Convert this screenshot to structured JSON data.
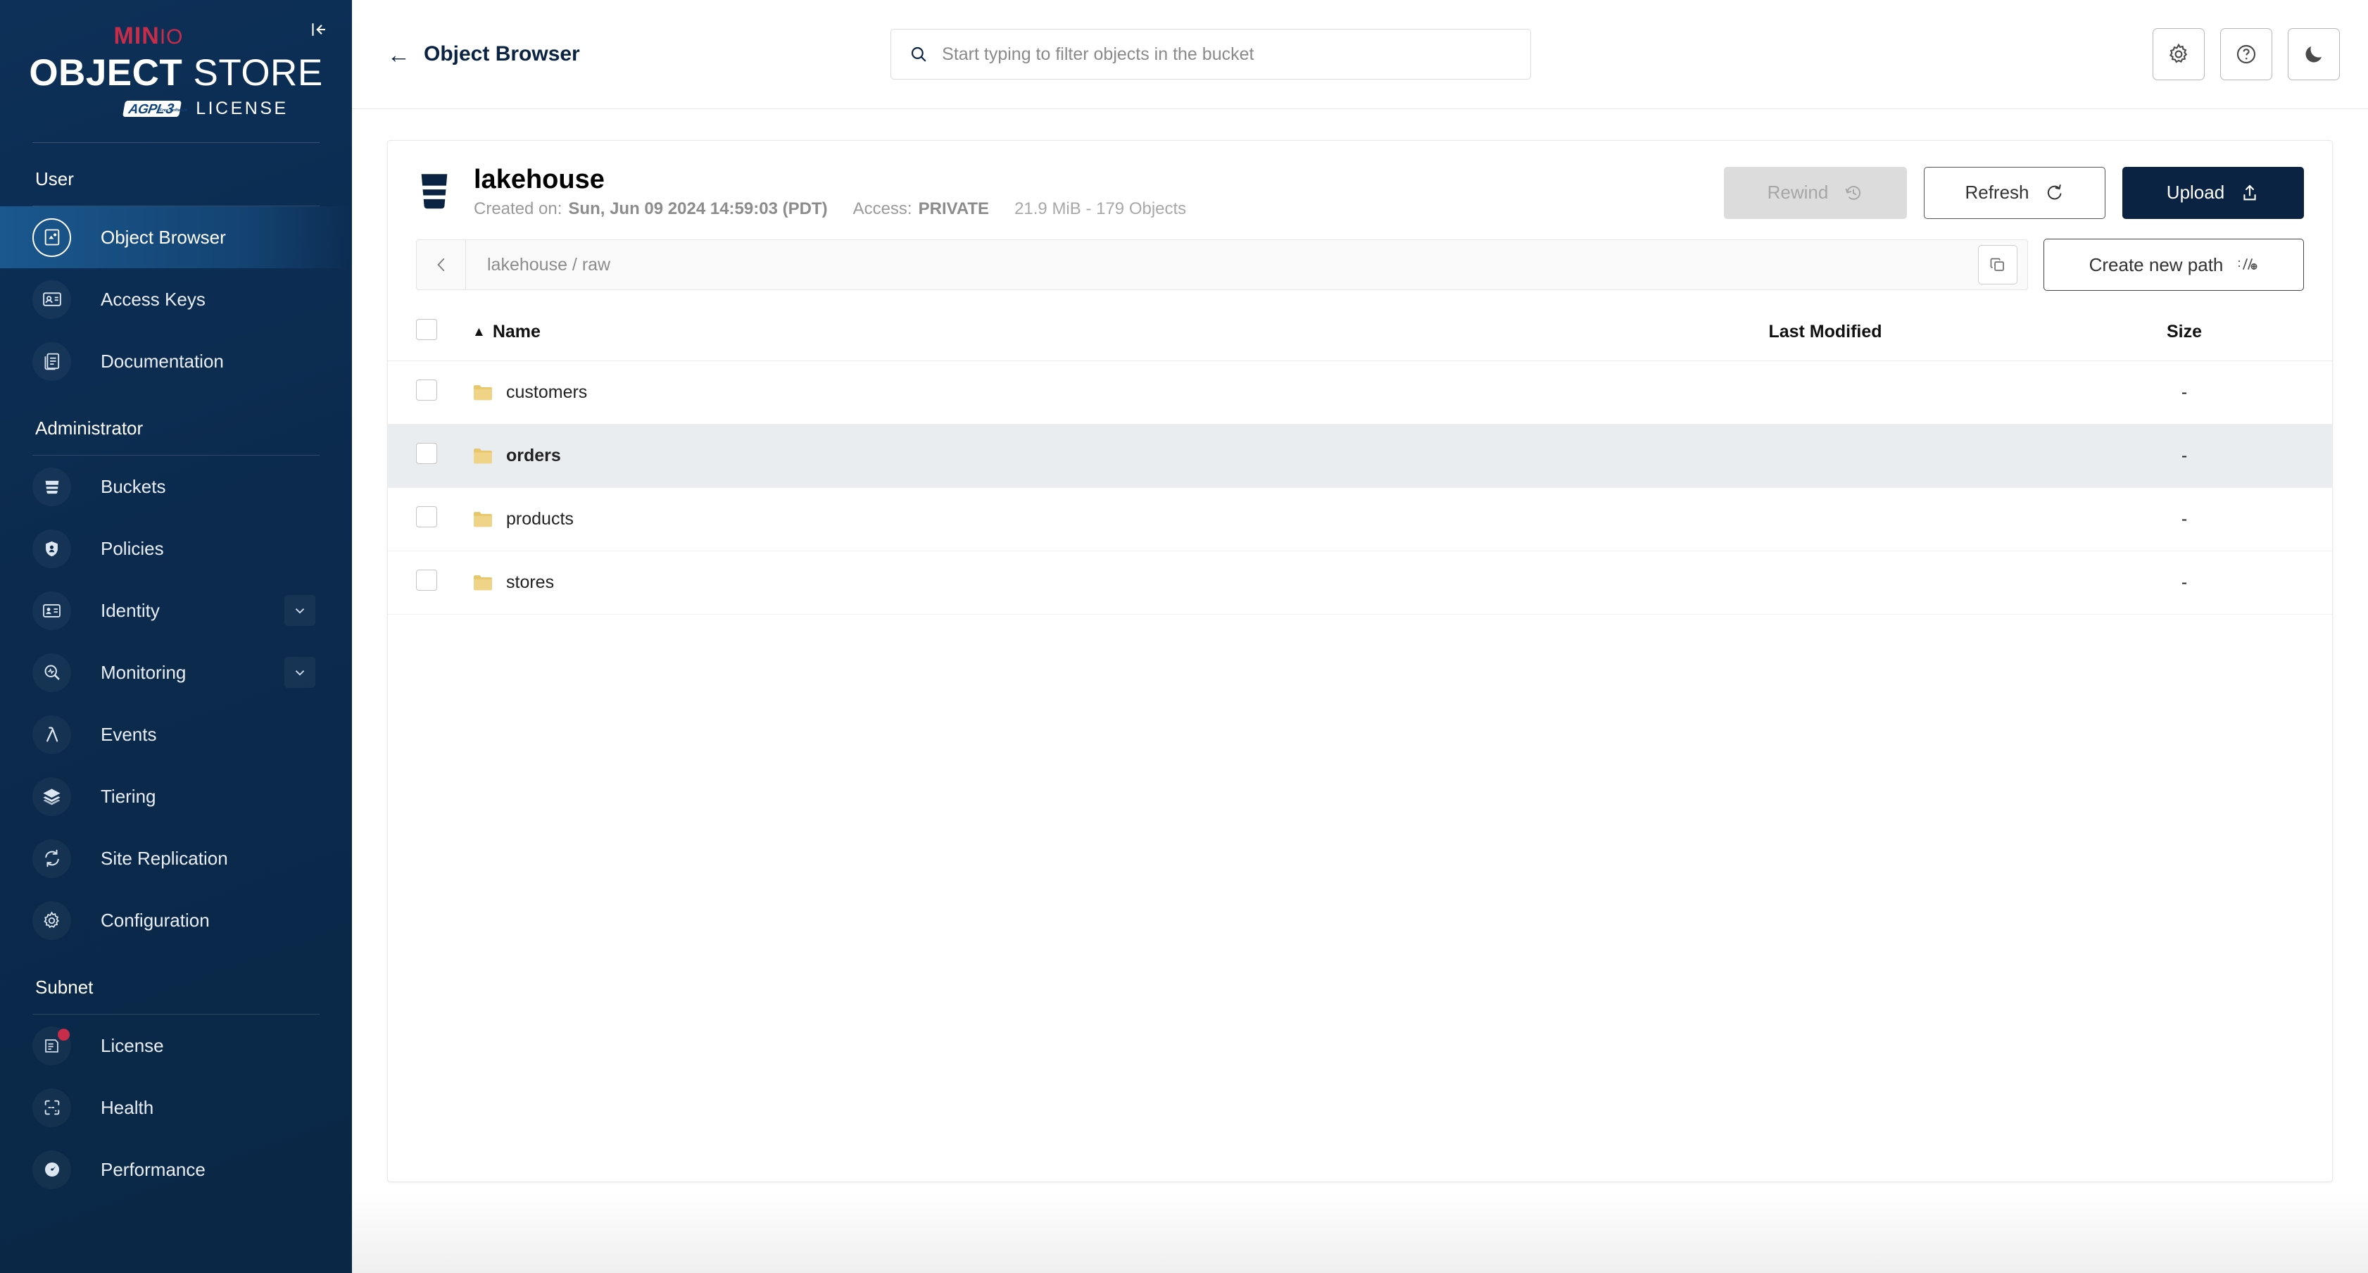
{
  "sidebar": {
    "logo": {
      "brand": "MIN",
      "brand_suffix": "IO",
      "product_bold": "OBJECT",
      "product_light": "STORE",
      "agpl": "AGPL",
      "agpl_sub": "Free Software",
      "agpl_version": "3",
      "license_label": "LICENSE"
    },
    "collapse_icon": "collapse-sidebar-icon",
    "sections": [
      {
        "label": "User",
        "items": [
          {
            "label": "Object Browser",
            "icon": "object-browser-icon",
            "active": true,
            "chevron": false,
            "badge": false
          },
          {
            "label": "Access Keys",
            "icon": "access-keys-icon",
            "active": false,
            "chevron": false,
            "badge": false
          },
          {
            "label": "Documentation",
            "icon": "documentation-icon",
            "active": false,
            "chevron": false,
            "badge": false
          }
        ]
      },
      {
        "label": "Administrator",
        "items": [
          {
            "label": "Buckets",
            "icon": "bucket-icon",
            "active": false,
            "chevron": false,
            "badge": false
          },
          {
            "label": "Policies",
            "icon": "policy-lock-icon",
            "active": false,
            "chevron": false,
            "badge": false
          },
          {
            "label": "Identity",
            "icon": "identity-card-icon",
            "active": false,
            "chevron": true,
            "badge": false
          },
          {
            "label": "Monitoring",
            "icon": "monitoring-magnifier-icon",
            "active": false,
            "chevron": true,
            "badge": false
          },
          {
            "label": "Events",
            "icon": "lambda-icon",
            "active": false,
            "chevron": false,
            "badge": false
          },
          {
            "label": "Tiering",
            "icon": "layers-icon",
            "active": false,
            "chevron": false,
            "badge": false
          },
          {
            "label": "Site Replication",
            "icon": "replication-icon",
            "active": false,
            "chevron": false,
            "badge": false
          },
          {
            "label": "Configuration",
            "icon": "gear-icon",
            "active": false,
            "chevron": false,
            "badge": false
          }
        ]
      },
      {
        "label": "Subnet",
        "items": [
          {
            "label": "License",
            "icon": "license-doc-icon",
            "active": false,
            "chevron": false,
            "badge": true
          },
          {
            "label": "Health",
            "icon": "health-icon",
            "active": false,
            "chevron": false,
            "badge": false
          },
          {
            "label": "Performance",
            "icon": "performance-gauge-icon",
            "active": false,
            "chevron": false,
            "badge": false
          }
        ]
      }
    ]
  },
  "topbar": {
    "back_icon": "back-arrow-icon",
    "title": "Object Browser",
    "search": {
      "icon": "search-icon",
      "value": "",
      "placeholder": "Start typing to filter objects in the bucket"
    },
    "actions": [
      {
        "name": "settings-button",
        "icon": "gear-icon"
      },
      {
        "name": "help-button",
        "icon": "question-circle-icon"
      },
      {
        "name": "dark-mode-button",
        "icon": "moon-icon"
      }
    ]
  },
  "bucket": {
    "icon": "bucket-icon",
    "name": "lakehouse",
    "created_label": "Created on:",
    "created_value": "Sun, Jun 09 2024 14:59:03 (PDT)",
    "access_label": "Access:",
    "access_value": "PRIVATE",
    "size_objects": "21.9 MiB - 179 Objects",
    "actions": {
      "rewind": {
        "label": "Rewind",
        "icon": "rewind-clock-icon",
        "disabled": true
      },
      "refresh": {
        "label": "Refresh",
        "icon": "refresh-icon",
        "disabled": false
      },
      "upload": {
        "label": "Upload",
        "icon": "upload-icon",
        "disabled": false
      }
    }
  },
  "pathbar": {
    "back_icon": "chevron-left-icon",
    "path": "lakehouse  /  raw",
    "copy_icon": "copy-icon",
    "create_path": {
      "label": "Create new path",
      "icon": "new-path-icon"
    }
  },
  "table": {
    "columns": {
      "name": "Name",
      "last_modified": "Last Modified",
      "size": "Size"
    },
    "sort_indicator": "▲",
    "rows": [
      {
        "name": "customers",
        "icon": "folder-icon",
        "last_modified": "",
        "size": "-",
        "highlighted": false
      },
      {
        "name": "orders",
        "icon": "folder-icon",
        "last_modified": "",
        "size": "-",
        "highlighted": true
      },
      {
        "name": "products",
        "icon": "folder-icon",
        "last_modified": "",
        "size": "-",
        "highlighted": false
      },
      {
        "name": "stores",
        "icon": "folder-icon",
        "last_modified": "",
        "size": "-",
        "highlighted": false
      }
    ]
  },
  "colors": {
    "sidebar_navy": "#0B2D52",
    "brand_red": "#C72C48",
    "primary_navy": "#0A2342",
    "folder_yellow": "#E8C66A",
    "row_highlight": "#E9EDF0"
  }
}
